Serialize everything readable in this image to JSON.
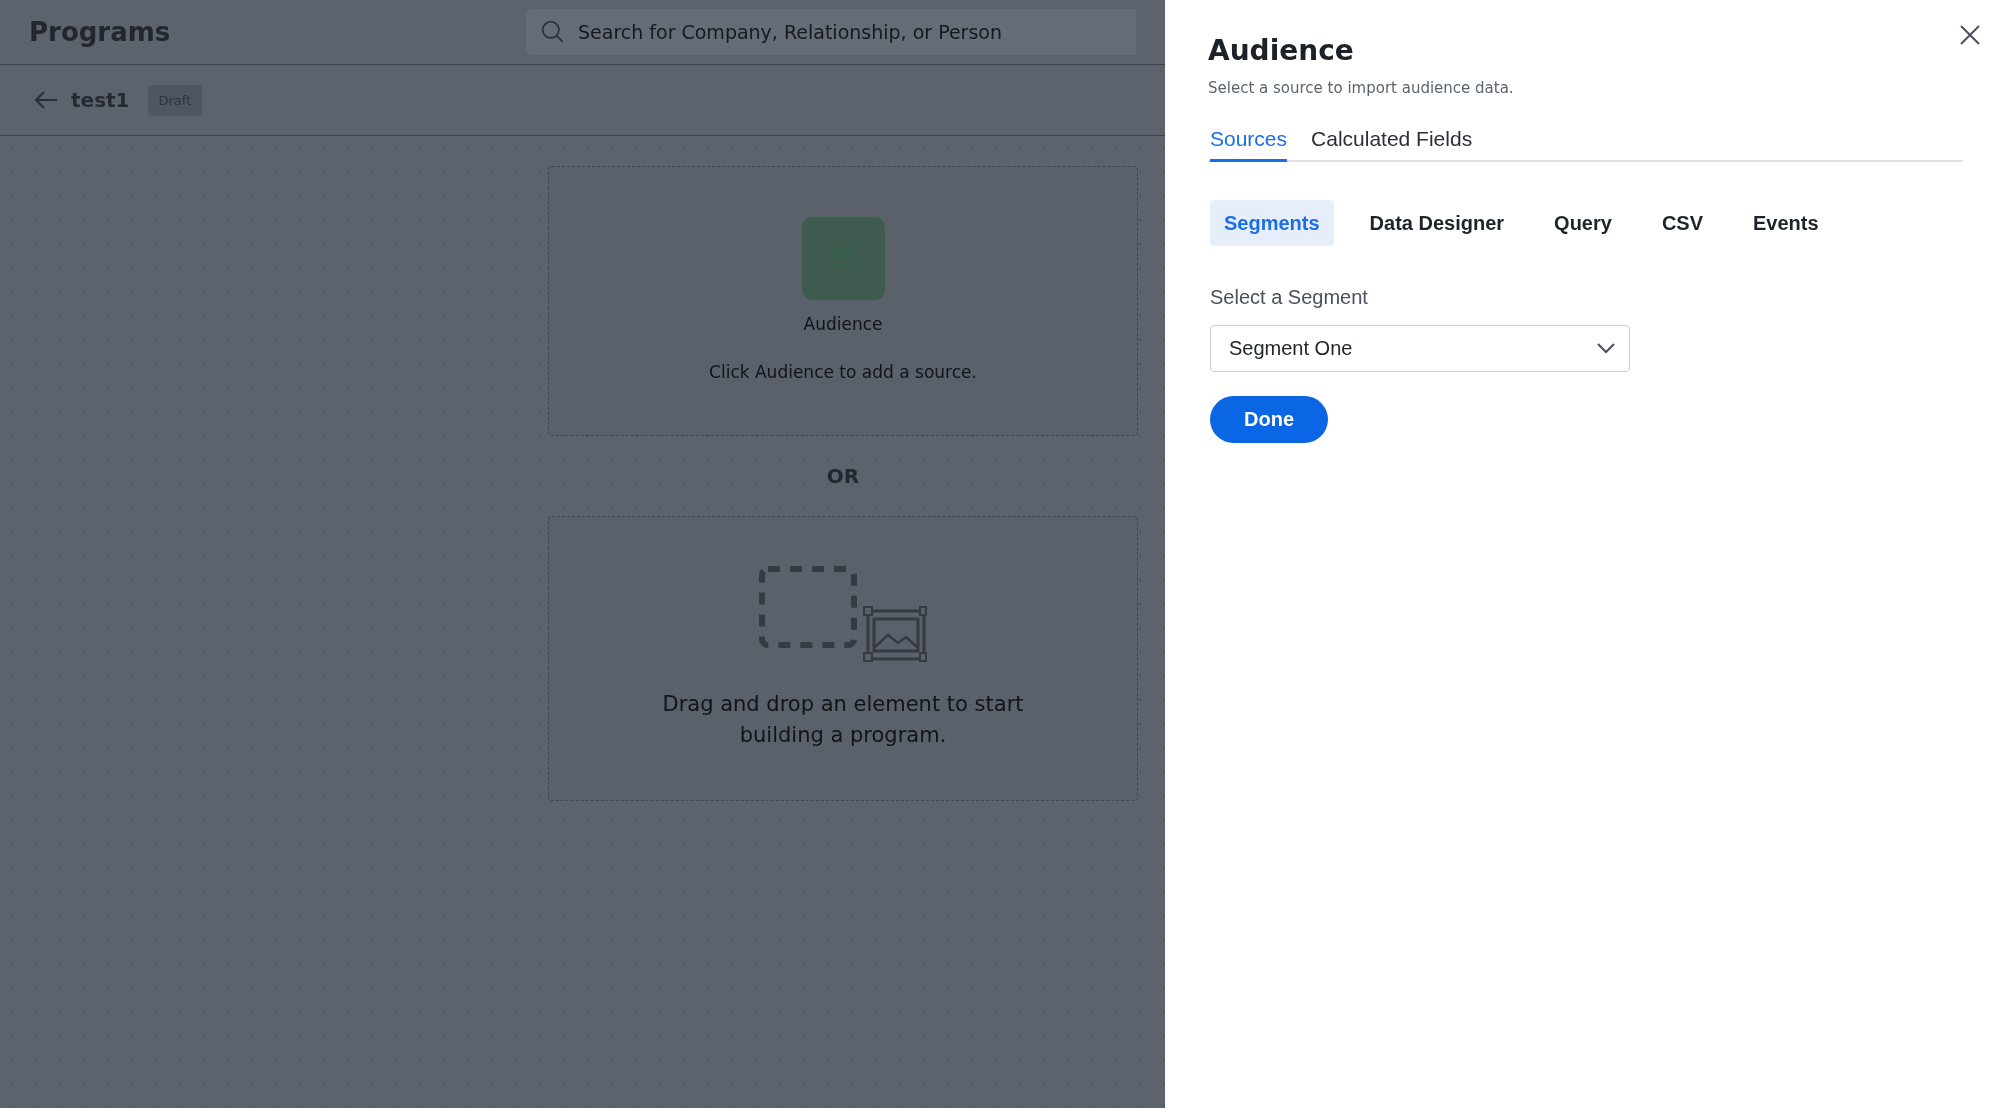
{
  "header": {
    "title": "Programs",
    "search": {
      "placeholder": "Search for Company, Relationship, or Person"
    }
  },
  "program": {
    "name": "test1",
    "status": "Draft"
  },
  "canvas": {
    "audience_card": {
      "label": "Audience",
      "hint": "Click Audience to add a source."
    },
    "divider": "OR",
    "dropzone": {
      "text": "Drag and drop an element to start building a program."
    }
  },
  "panel": {
    "title": "Audience",
    "subtitle": "Select a source to import audience data.",
    "tabs": [
      {
        "label": "Sources",
        "selected": true
      },
      {
        "label": "Calculated Fields",
        "selected": false
      }
    ],
    "source_tabs": [
      {
        "label": "Segments",
        "selected": true
      },
      {
        "label": "Data Designer",
        "selected": false
      },
      {
        "label": "Query",
        "selected": false
      },
      {
        "label": "CSV",
        "selected": false
      },
      {
        "label": "Events",
        "selected": false
      }
    ],
    "segment_field": {
      "label": "Select a Segment",
      "value": "Segment One"
    },
    "done_button": "Done"
  }
}
